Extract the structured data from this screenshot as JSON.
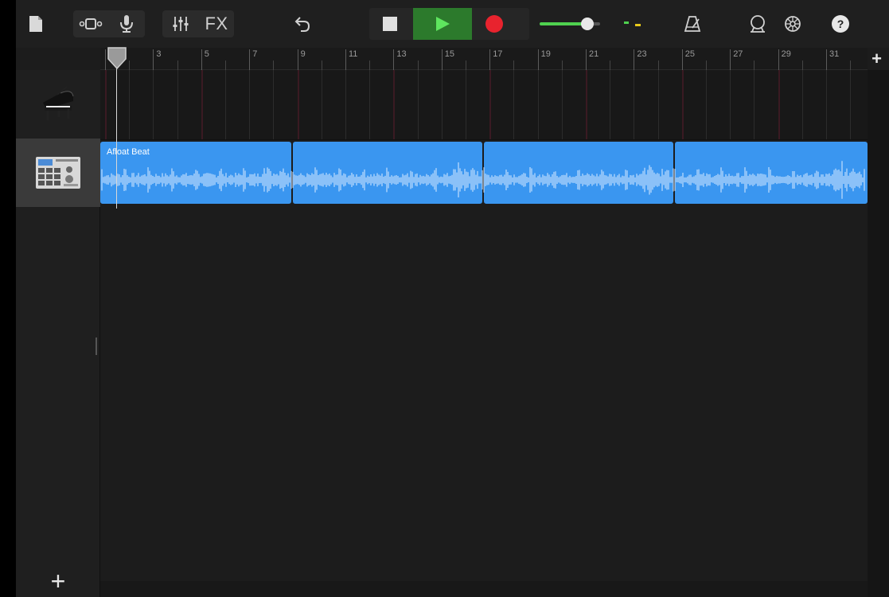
{
  "toolbar": {
    "fx_label": "FX",
    "icons": [
      "my-songs-icon",
      "browser-icon",
      "mic-icon",
      "mixer-icon",
      "fx-icon",
      "undo-icon",
      "stop-icon",
      "play-icon",
      "record-icon",
      "volume-slider",
      "level-meter",
      "metronome-icon",
      "loop-browser-icon",
      "settings-icon",
      "help-icon"
    ],
    "help_label": "?"
  },
  "transport": {
    "play_color": "#2c7a2c",
    "record_color": "#e8232e",
    "volume": 0.75
  },
  "ruler": {
    "bar_numbers": [
      "3",
      "5",
      "7",
      "9",
      "11",
      "13",
      "15",
      "17",
      "19",
      "21",
      "23",
      "25",
      "27",
      "29",
      "31"
    ],
    "add_section_label": "+"
  },
  "tracks": [
    {
      "instrument": "piano-icon",
      "selected": false
    },
    {
      "instrument": "drum-machine-icon",
      "selected": true
    }
  ],
  "region": {
    "name": "Afloat Beat",
    "color": "#3a96f0"
  },
  "add_track_label": "+"
}
